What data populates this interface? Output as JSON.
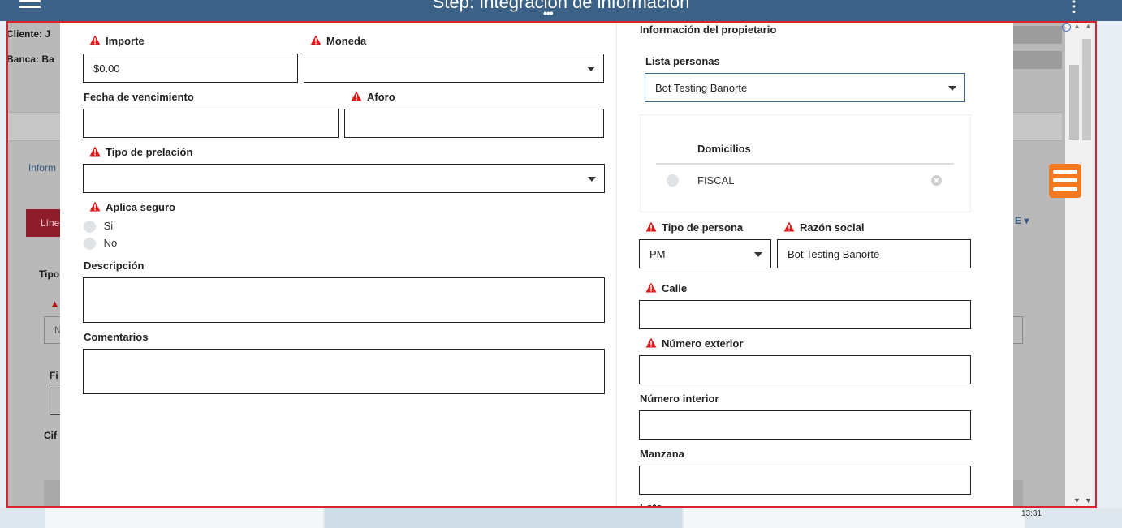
{
  "topbar": {
    "title": "Step: Integración de información",
    "kebab": "⋮"
  },
  "background": {
    "cliente_label": "Cliente: J",
    "banca_label": "Banca: Ba",
    "inform_label": "Inform",
    "tab_label": "Líne",
    "tipo_label": "Tipo",
    "n_label": "N",
    "fi_label": "Fi",
    "cif_label": "Cif",
    "e_label": "E ▾",
    "clock": "13:31"
  },
  "form_left": {
    "importe": {
      "label": "Importe",
      "value": "$0.00"
    },
    "moneda": {
      "label": "Moneda",
      "value": ""
    },
    "fecha_vencimiento": {
      "label": "Fecha de vencimiento",
      "value": ""
    },
    "aforo": {
      "label": "Aforo",
      "value": ""
    },
    "tipo_prelacion": {
      "label": "Tipo de prelación",
      "value": ""
    },
    "aplica_seguro": {
      "label": "Aplica seguro",
      "options": [
        "Si",
        "No"
      ]
    },
    "descripcion": {
      "label": "Descripción",
      "value": ""
    },
    "comentarios": {
      "label": "Comentarios",
      "value": ""
    }
  },
  "form_right": {
    "section_title": "Información del propietario",
    "lista_personas": {
      "label": "Lista personas",
      "value": "Bot Testing Banorte"
    },
    "domicilios": {
      "header": "Domicilios",
      "items": [
        "FISCAL"
      ]
    },
    "tipo_persona": {
      "label": "Tipo de persona",
      "value": "PM"
    },
    "razon_social": {
      "label": "Razón social",
      "value": "Bot Testing Banorte"
    },
    "calle": {
      "label": "Calle",
      "value": ""
    },
    "numero_exterior": {
      "label": "Número exterior",
      "value": ""
    },
    "numero_interior": {
      "label": "Número interior",
      "value": ""
    },
    "manzana": {
      "label": "Manzana",
      "value": ""
    },
    "lote": {
      "label": "Lote"
    }
  },
  "colors": {
    "header": "#3b6286",
    "required": "#e01b1b",
    "fab": "#f37a21",
    "frame": "#d9232f"
  },
  "icons": {
    "required": "warning-triangle-icon",
    "menu": "hamburger-icon",
    "fab": "menu-fab-icon"
  }
}
